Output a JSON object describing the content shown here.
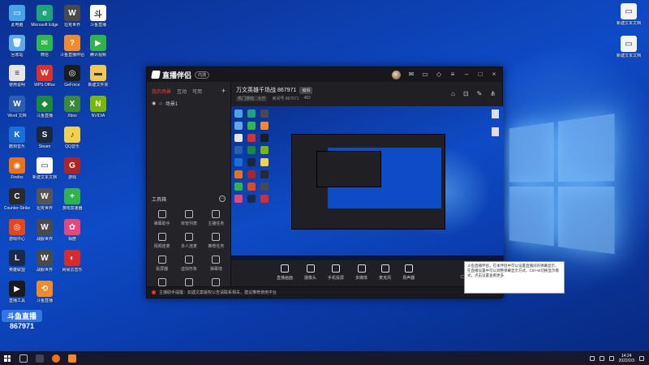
{
  "desktop": {
    "icons_left": [
      {
        "label": "此电脑",
        "color": "#4aa3e6",
        "glyph": "▭"
      },
      {
        "label": "Microsoft Edge",
        "color": "#1fa37a",
        "glyph": "e"
      },
      {
        "label": "坦克世界",
        "color": "#4a4a4a",
        "glyph": "W"
      },
      {
        "label": "斗鱼直播",
        "color": "#ffffff",
        "glyph": "斗"
      },
      {
        "label": "回收站",
        "color": "#5fa9e8",
        "glyph": "🗑"
      },
      {
        "label": "微信",
        "color": "#2db84d",
        "glyph": "✉"
      },
      {
        "label": "斗鱼直播伴侣",
        "color": "#f08a2a",
        "glyph": "?"
      },
      {
        "label": "腾讯视频",
        "color": "#32b24a",
        "glyph": "▶"
      },
      {
        "label": "使用说明",
        "color": "#e6e6e6",
        "glyph": "≡"
      },
      {
        "label": "WPS Office",
        "color": "#d9322c",
        "glyph": "W"
      },
      {
        "label": "GeForce",
        "color": "#1c1c1c",
        "glyph": "◎"
      },
      {
        "label": "新建文件夹",
        "color": "#f2c94c",
        "glyph": "▬"
      },
      {
        "label": "Word 文档",
        "color": "#2a5fb0",
        "glyph": "W"
      },
      {
        "label": "斗鱼直播",
        "color": "#1a8a3a",
        "glyph": "◆"
      },
      {
        "label": "Xbox",
        "color": "#3a8a3a",
        "glyph": "X"
      },
      {
        "label": "NVIDIA",
        "color": "#76b900",
        "glyph": "N"
      },
      {
        "label": "酷狗音乐",
        "color": "#1a6ed8",
        "glyph": "K"
      },
      {
        "label": "Steam",
        "color": "#1b2838",
        "glyph": "S"
      },
      {
        "label": "QQ音乐",
        "color": "#f2d04a",
        "glyph": "♪"
      },
      {
        "label": "Firefox",
        "color": "#e8731b",
        "glyph": "◉"
      },
      {
        "label": "新建文本文档",
        "color": "#ffffff",
        "glyph": "▭"
      },
      {
        "label": "游戏",
        "color": "#b02424",
        "glyph": "G"
      },
      {
        "label": "Counter-Strike",
        "color": "#2a2a2a",
        "glyph": "C"
      },
      {
        "label": "坦克世界",
        "color": "#555555",
        "glyph": "W"
      },
      {
        "label": "游戏加速器",
        "color": "#2fb34a",
        "glyph": "+"
      },
      {
        "label": "游戏中心",
        "color": "#e8461a",
        "glyph": "◎"
      },
      {
        "label": "战舰世界",
        "color": "#4a4a4a",
        "glyph": "W"
      },
      {
        "label": "相册",
        "color": "#e8457a",
        "glyph": "✿"
      },
      {
        "label": "英雄联盟",
        "color": "#1a2a4a",
        "glyph": "L"
      },
      {
        "label": "战舰世界",
        "color": "#4a4a4a",
        "glyph": "W"
      },
      {
        "label": "网易云音乐",
        "color": "#d92b2b",
        "glyph": "◐"
      },
      {
        "label": "直播工具",
        "color": "#1a1a1a",
        "glyph": "▶"
      },
      {
        "label": "斗鱼直播",
        "color": "#f08a2a",
        "glyph": "⟲"
      }
    ],
    "icons_right": [
      {
        "label": "新建文本文档",
        "glyph": "▭"
      },
      {
        "label": "新建文本文档",
        "glyph": "▭"
      }
    ]
  },
  "app": {
    "logo": "直播伴侣",
    "badge": "内测",
    "tabs": [
      "我的场景",
      "互动",
      "可用"
    ],
    "plus": "+",
    "scene": "场景1",
    "tools_title": "工具箱",
    "tools": [
      {
        "label": "弹幕助手"
      },
      {
        "label": "房管列表"
      },
      {
        "label": "主播任务"
      },
      {
        "label": "视频连麦"
      },
      {
        "label": "多人连麦"
      },
      {
        "label": "推荐任务"
      },
      {
        "label": "投屏器"
      },
      {
        "label": "虚拟形象"
      },
      {
        "label": "弹幕墙"
      },
      {
        "label": "数据"
      },
      {
        "label": "直播PK"
      },
      {
        "label": "更多"
      }
    ],
    "room_title": "万文英雄千场战 867971",
    "room_chip": "编辑",
    "room_sub_tag": "热门游戏 · 大厅",
    "room_sub_id": "房间号 867971",
    "room_sub_count": "482",
    "bottom_bar": [
      {
        "label": "直播画面"
      },
      {
        "label": "摄像头"
      },
      {
        "label": "手机投屏"
      },
      {
        "label": "多媒体"
      },
      {
        "label": "麦克风"
      },
      {
        "label": "扬声器"
      }
    ],
    "notice": "主播助手提醒：如遇文案版权公告请联系相关，建议推荐使用平台",
    "tooltip": "斗鱼直播伴侣，在本伴侣中可以设置直播间的弹幕显示，在直播设置中可以调整弹幕显示方式，Ctrl+W切换显示模式，点击设置查看更多"
  },
  "watermark": {
    "top": "斗鱼直播",
    "num": "867971"
  },
  "taskbar": {
    "time": "14:24",
    "date": "2022/2/3"
  }
}
